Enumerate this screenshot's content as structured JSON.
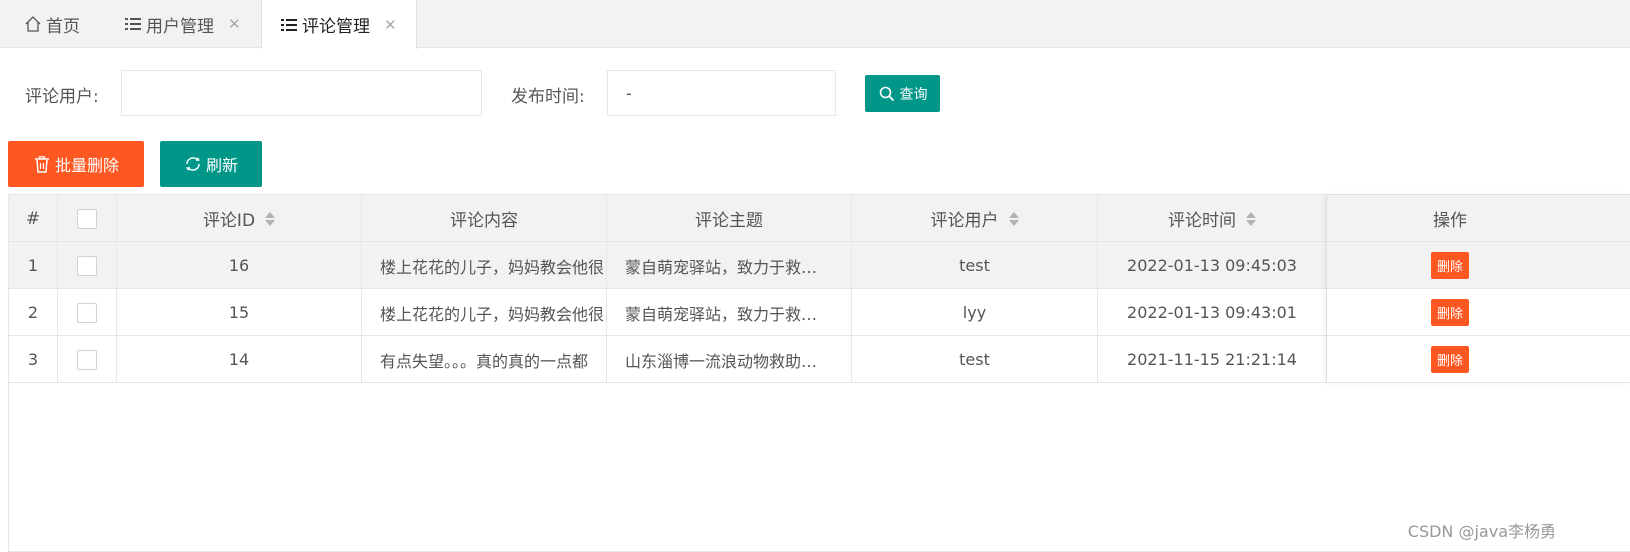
{
  "tabs": [
    {
      "label": "首页",
      "icon": "home-icon"
    },
    {
      "label": "用户管理",
      "icon": "list-icon",
      "closable": true
    },
    {
      "label": "评论管理",
      "icon": "list-icon",
      "closable": true,
      "active": true
    }
  ],
  "search": {
    "user_label": "评论用户:",
    "user_value": "",
    "time_label": "发布时间:",
    "time_value": "-",
    "query_label": "查询"
  },
  "toolbar": {
    "batch_delete_label": "批量删除",
    "refresh_label": "刷新"
  },
  "table": {
    "headers": {
      "index": "#",
      "id": "评论ID",
      "content": "评论内容",
      "topic": "评论主题",
      "user": "评论用户",
      "time": "评论时间",
      "actions": "操作"
    },
    "rows": [
      {
        "index": "1",
        "id": "16",
        "content": "楼上花花的儿子，妈妈教会他很",
        "topic": "蒙自萌宠驿站，致力于救…",
        "user": "test",
        "time": "2022-01-13 09:45:03",
        "action": "删除"
      },
      {
        "index": "2",
        "id": "15",
        "content": "楼上花花的儿子，妈妈教会他很",
        "topic": "蒙自萌宠驿站，致力于救…",
        "user": "lyy",
        "time": "2022-01-13 09:43:01",
        "action": "删除"
      },
      {
        "index": "3",
        "id": "14",
        "content": "有点失望。。。真的真的一点都",
        "topic": "山东淄博一流浪动物救助…",
        "user": "test",
        "time": "2021-11-15 21:21:14",
        "action": "删除"
      }
    ]
  },
  "watermark": "CSDN @java李杨勇",
  "colors": {
    "teal": "#009688",
    "orange": "#ff5722"
  }
}
